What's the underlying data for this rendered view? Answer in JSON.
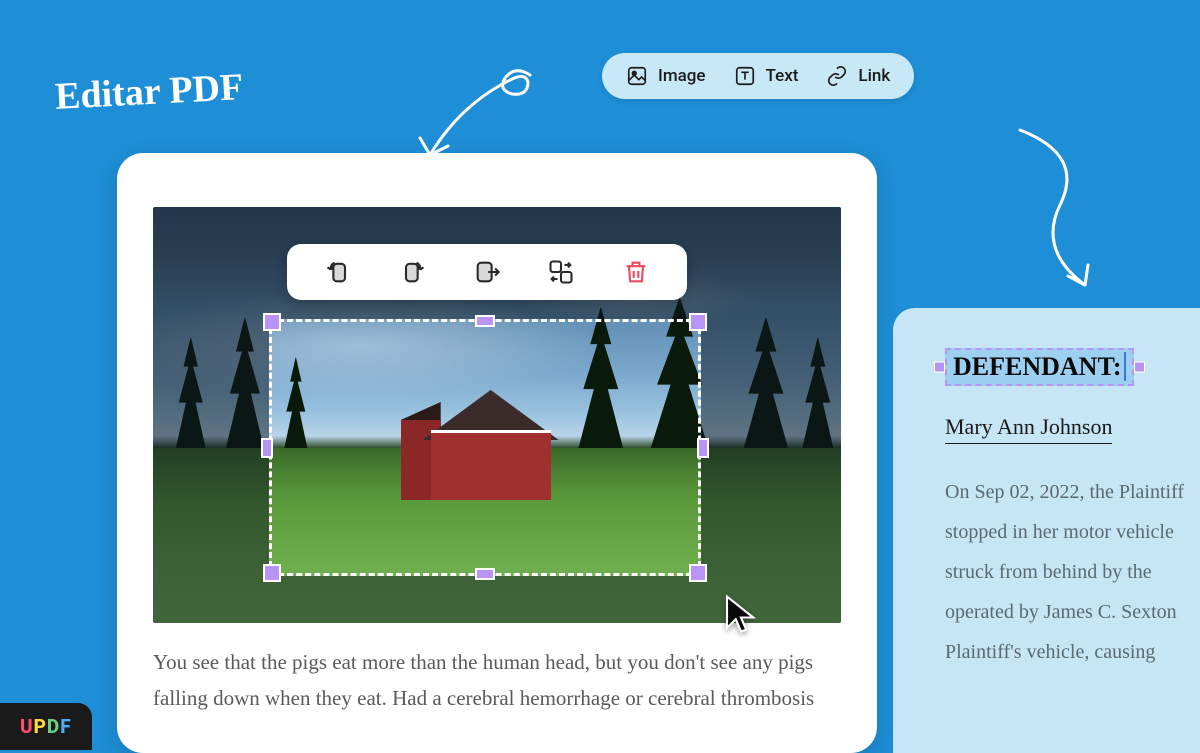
{
  "title": "Editar PDF",
  "toolbar": {
    "image": "Image",
    "text": "Text",
    "link": "Link"
  },
  "image_toolbar": {
    "rotate_left": "rotate-left",
    "rotate_right": "rotate-right",
    "extract": "extract",
    "replace": "replace",
    "delete": "delete"
  },
  "main_text": "You see that the pigs eat more than the human head, but you don't see any pigs falling down when they eat. Had a cerebral hemorrhage or cerebral thrombosis",
  "side": {
    "heading": "DEFENDANT:",
    "name": "Mary Ann Johnson",
    "body": "On Sep 02, 2022, the Plaintiff stopped in her motor vehicle struck from behind by the operated by James C. Sexton Plaintiff's vehicle, causing"
  },
  "logo": {
    "u": "U",
    "p": "P",
    "d": "D",
    "f": "F"
  }
}
